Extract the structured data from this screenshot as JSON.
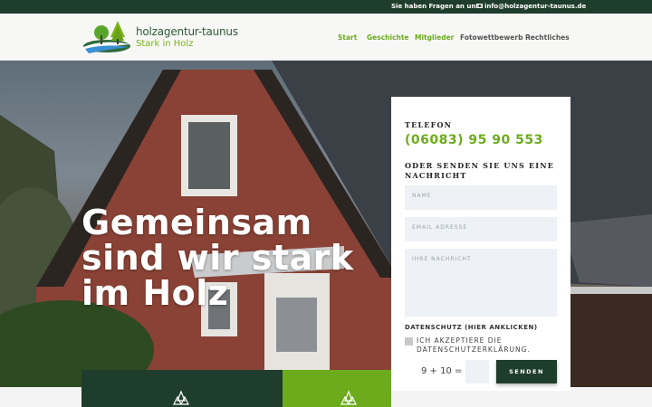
{
  "topbar": {
    "question": "Sie haben Fragen an uns?",
    "email": "info@holzagentur-taunus.de",
    "mail_icon": "envelope-icon"
  },
  "logo": {
    "name": "holzagentur-taunus",
    "tagline": "Stark in Holz"
  },
  "nav": {
    "items": [
      {
        "label": "Start",
        "active": true
      },
      {
        "label": "Geschichte",
        "active": true
      },
      {
        "label": "Mitglieder",
        "active": true
      },
      {
        "label": "Fotowettbewerb",
        "active": false
      },
      {
        "label": "Rechtliches",
        "active": false,
        "dropdown": true
      }
    ]
  },
  "hero": {
    "lines": [
      "Gemeinsam",
      "sind wir stark",
      "im Holz"
    ]
  },
  "contact": {
    "phone_label": "TELEFON",
    "phone": "(06083) 95 90 553",
    "message_heading": "ODER SENDEN SIE UNS EINE NACHRICHT",
    "name_placeholder": "NAME",
    "email_placeholder": "EMAIL ADRESSE",
    "message_placeholder": "IHRE NACHRICHT",
    "privacy_link": "DATENSCHUTZ (HIER ANKLICKEN)",
    "accept_text": "ICH AKZEPTIERE DIE DATENSCHUTZERKLÄRUNG.",
    "captcha": "9 + 10 =",
    "send_label": "SENDEN"
  },
  "colors": {
    "dark_green": "#1f3d2c",
    "accent_green": "#6cac1c"
  }
}
